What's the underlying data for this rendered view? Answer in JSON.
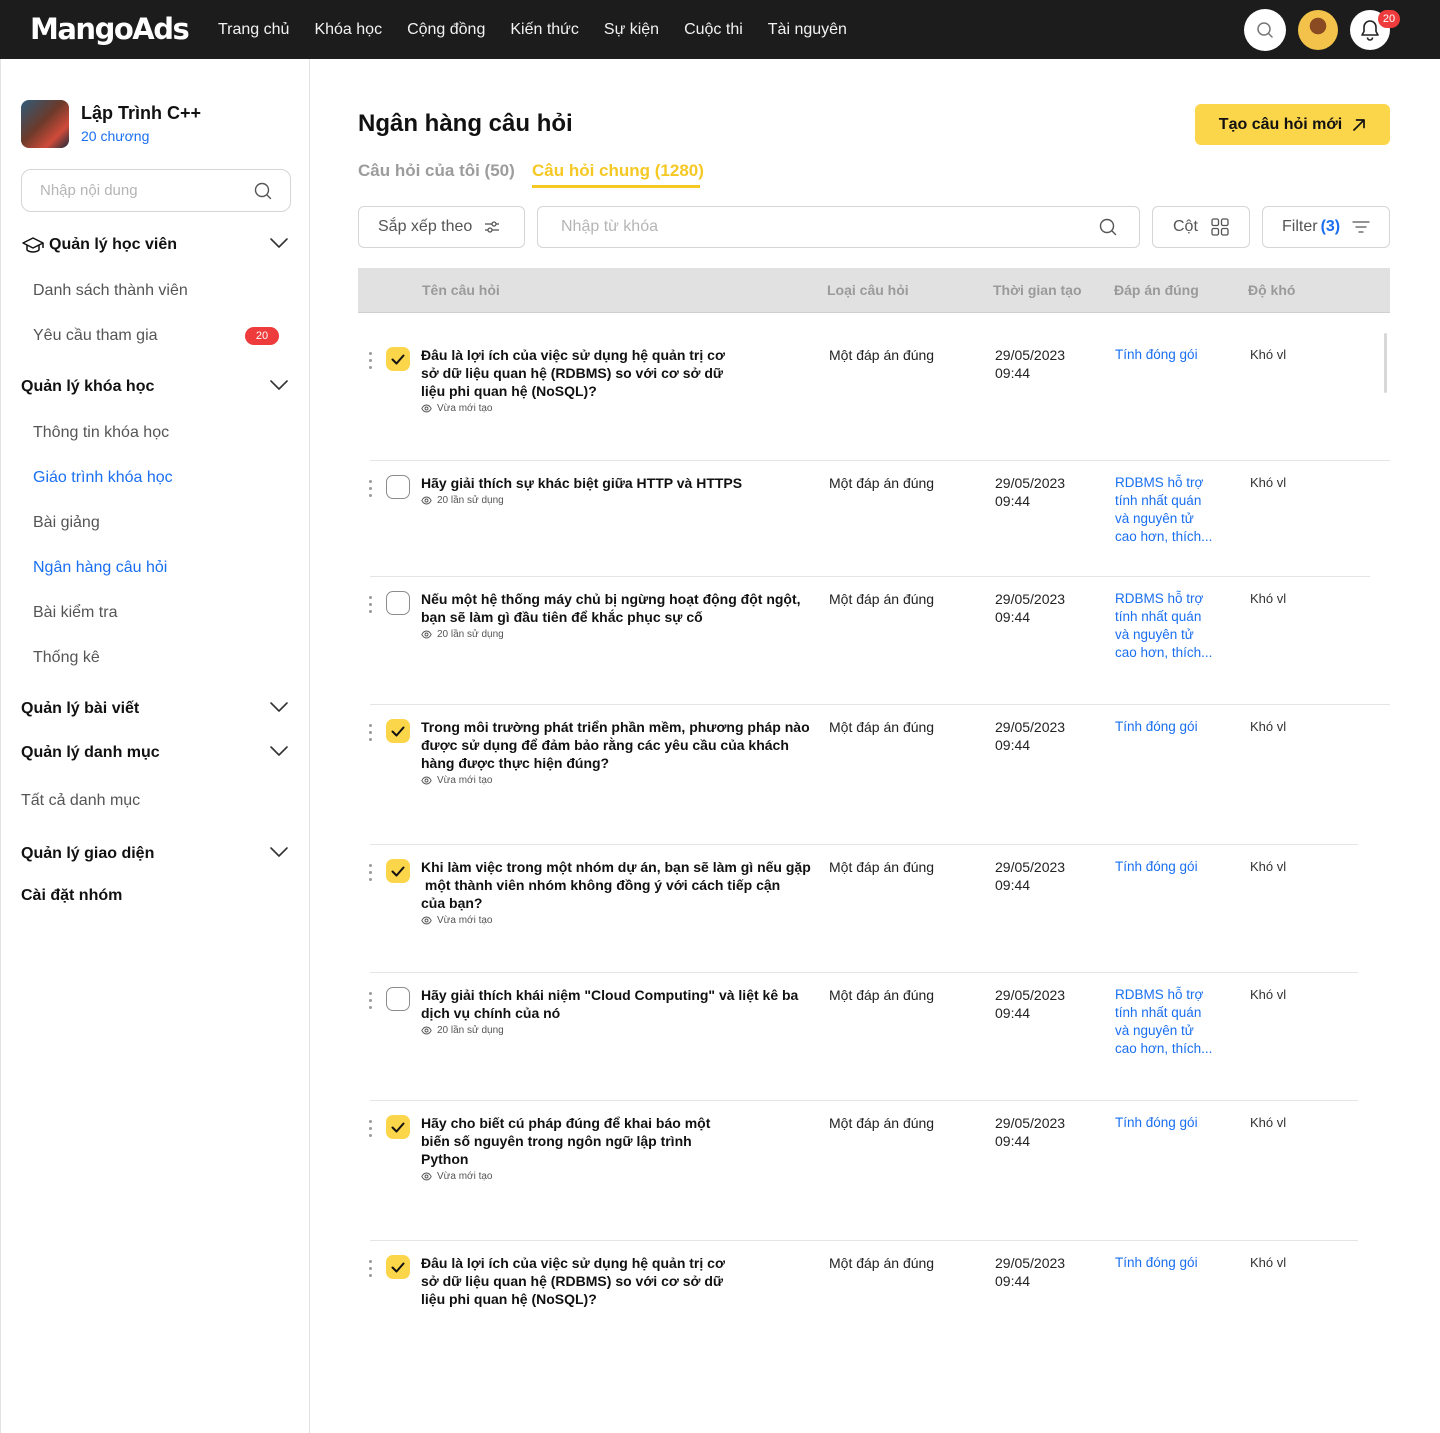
{
  "brand": {
    "logo": "MangoAds"
  },
  "nav": [
    "Trang chủ",
    "Khóa học",
    "Cộng đồng",
    "Kiến thức",
    "Sự kiện",
    "Cuộc thi",
    "Tài nguyên"
  ],
  "notifications": {
    "count": "20"
  },
  "sidebar": {
    "course_title": "Lập Trình C++",
    "course_chapters": "20 chương",
    "search_placeholder": "Nhập nội dung",
    "sections": {
      "students": {
        "title": "Quản lý học viên",
        "items": [
          "Danh sách thành viên",
          "Yêu cầu tham gia"
        ],
        "request_badge": "20"
      },
      "courses": {
        "title": "Quản lý khóa học",
        "items": [
          "Thông tin khóa học",
          "Giáo trình khóa học",
          "Bài giảng",
          "Ngân hàng câu hỏi",
          "Bài kiểm tra",
          "Thống kê"
        ]
      },
      "posts": {
        "title": "Quản lý bài viết"
      },
      "categories": {
        "title": "Quản lý danh mục",
        "items": [
          "Tất cả danh mục"
        ]
      },
      "ui": {
        "title": "Quản lý giao diện"
      },
      "group": {
        "title": "Cài đặt nhóm"
      }
    }
  },
  "main": {
    "title": "Ngân hàng câu hỏi",
    "create_button": "Tạo câu hỏi mới",
    "tabs": {
      "mine": "Câu hỏi của tôi (50)",
      "common": "Câu hỏi chung (1280)"
    },
    "sort_label": "Sắp xếp theo",
    "keyword_placeholder": "Nhập từ khóa",
    "columns_label": "Cột",
    "filter_label": "Filter",
    "filter_count": "(3)",
    "table_headers": [
      "Tên câu hỏi",
      "Loại câu hỏi",
      "Thời gian tạo",
      "Đáp án đúng",
      "Độ khó"
    ],
    "rows": [
      {
        "checked": true,
        "question": [
          "Đâu là lợi ích của việc sử dụng hệ quản trị cơ",
          "sở dữ liệu quan hệ (RDBMS) so với cơ sở dữ",
          "liệu phi quan hệ (NoSQL)?"
        ],
        "meta": "Vừa mới tạo",
        "type": "Một đáp án đúng",
        "date": "29/05/2023",
        "time": "09:44",
        "answer": [
          "Tính đóng gói"
        ],
        "difficulty": "Khó vl"
      },
      {
        "checked": false,
        "question": [
          "Hãy giải thích sự khác biệt giữa HTTP và HTTPS"
        ],
        "meta": "20 lần sử dụng",
        "type": "Một đáp án đúng",
        "date": "29/05/2023",
        "time": "09:44",
        "answer": [
          "RDBMS hỗ trợ",
          "tính nhất quán",
          "và nguyên tử",
          "cao hơn, thích..."
        ],
        "difficulty": "Khó vl"
      },
      {
        "checked": false,
        "question": [
          "Nếu một hệ thống máy chủ bị ngừng hoạt động đột ngột,",
          "bạn sẽ làm gì đầu tiên để khắc phục sự cố"
        ],
        "meta": "20 lần sử dụng",
        "type": "Một đáp án đúng",
        "date": "29/05/2023",
        "time": "09:44",
        "answer": [
          "RDBMS hỗ trợ",
          "tính nhất quán",
          "và nguyên tử",
          "cao hơn, thích..."
        ],
        "difficulty": "Khó vl"
      },
      {
        "checked": true,
        "question": [
          "Trong môi trường phát triển phần mềm, phương pháp nào",
          "được sử dụng để đảm bảo rằng các yêu cầu của khách",
          "hàng được thực hiện đúng?"
        ],
        "meta": "Vừa mới tạo",
        "type": "Một đáp án đúng",
        "date": "29/05/2023",
        "time": "09:44",
        "answer": [
          "Tính đóng gói"
        ],
        "difficulty": "Khó vl"
      },
      {
        "checked": true,
        "question": [
          "Khi làm việc trong một nhóm dự án, bạn sẽ làm gì nếu gặp",
          " một thành viên nhóm không đồng ý với cách tiếp cận",
          "của bạn?"
        ],
        "meta": "Vừa mới tạo",
        "type": "Một đáp án đúng",
        "date": "29/05/2023",
        "time": "09:44",
        "answer": [
          "Tính đóng gói"
        ],
        "difficulty": "Khó vl"
      },
      {
        "checked": false,
        "question": [
          "Hãy giải thích khái niệm \"Cloud Computing\" và liệt kê ba",
          "dịch vụ chính của nó"
        ],
        "meta": "20 lần sử dụng",
        "type": "Một đáp án đúng",
        "date": "29/05/2023",
        "time": "09:44",
        "answer": [
          "RDBMS hỗ trợ",
          "tính nhất quán",
          "và nguyên tử",
          "cao hơn, thích..."
        ],
        "difficulty": "Khó vl"
      },
      {
        "checked": true,
        "question": [
          "Hãy cho biết cú pháp đúng để khai báo một",
          "biến số nguyên trong ngôn ngữ lập trình",
          "Python"
        ],
        "meta": "Vừa mới tạo",
        "type": "Một đáp án đúng",
        "date": "29/05/2023",
        "time": "09:44",
        "answer": [
          "Tính đóng gói"
        ],
        "difficulty": "Khó vl"
      },
      {
        "checked": true,
        "question": [
          "Đâu là lợi ích của việc sử dụng hệ quản trị cơ",
          "sở dữ liệu quan hệ (RDBMS) so với cơ sở dữ",
          "liệu phi quan hệ (NoSQL)?"
        ],
        "meta": "",
        "type": "Một đáp án đúng",
        "date": "29/05/2023",
        "time": "09:44",
        "answer": [
          "Tính đóng gói"
        ],
        "difficulty": "Khó vl"
      }
    ]
  },
  "colors": {
    "accent": "#fbd54a",
    "link": "#1a6ff0",
    "badge": "#ee3b3b",
    "topbar": "#1c1c1c"
  }
}
